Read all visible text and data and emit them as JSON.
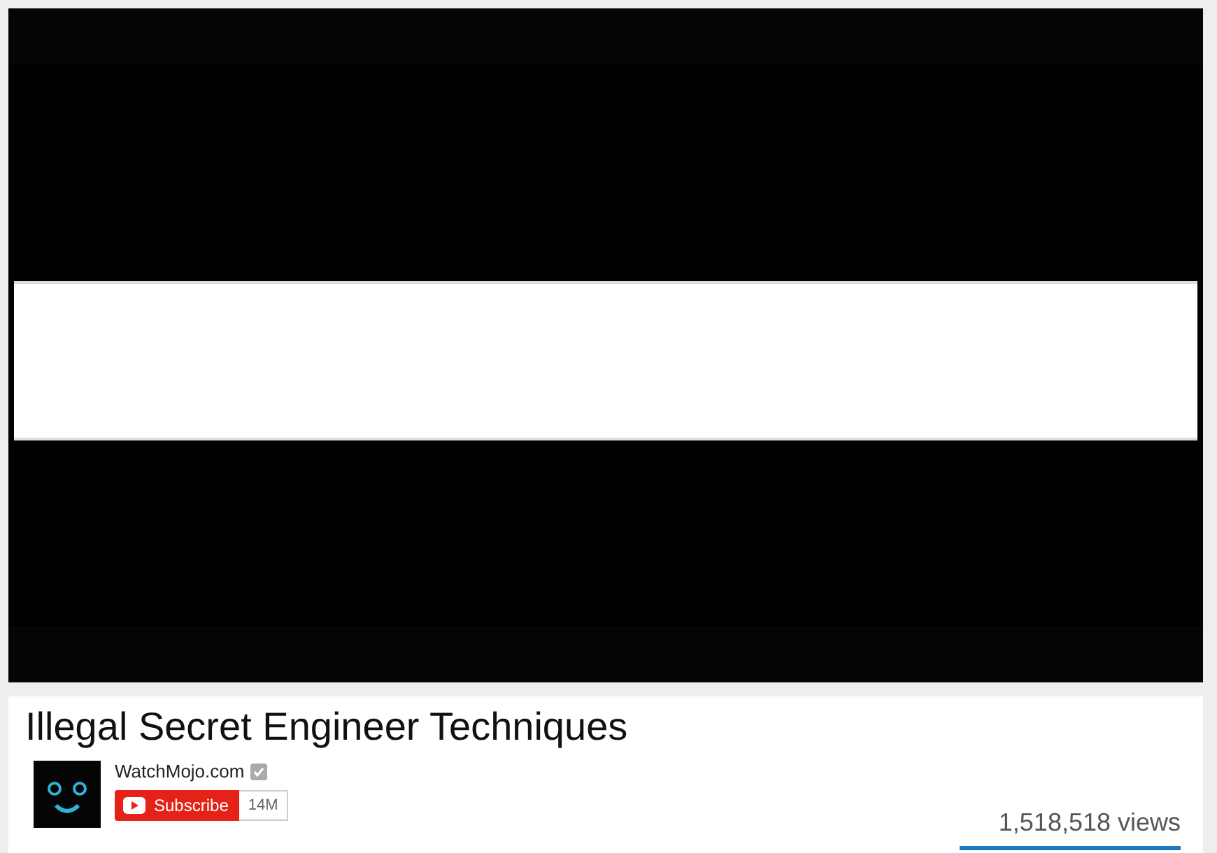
{
  "title": "Illegal Secret Engineer Techniques",
  "channel": {
    "name": "WatchMojo.com",
    "verified": true
  },
  "subscribe": {
    "label": "Subscribe",
    "count": "14M"
  },
  "views": "1,518,518 views"
}
